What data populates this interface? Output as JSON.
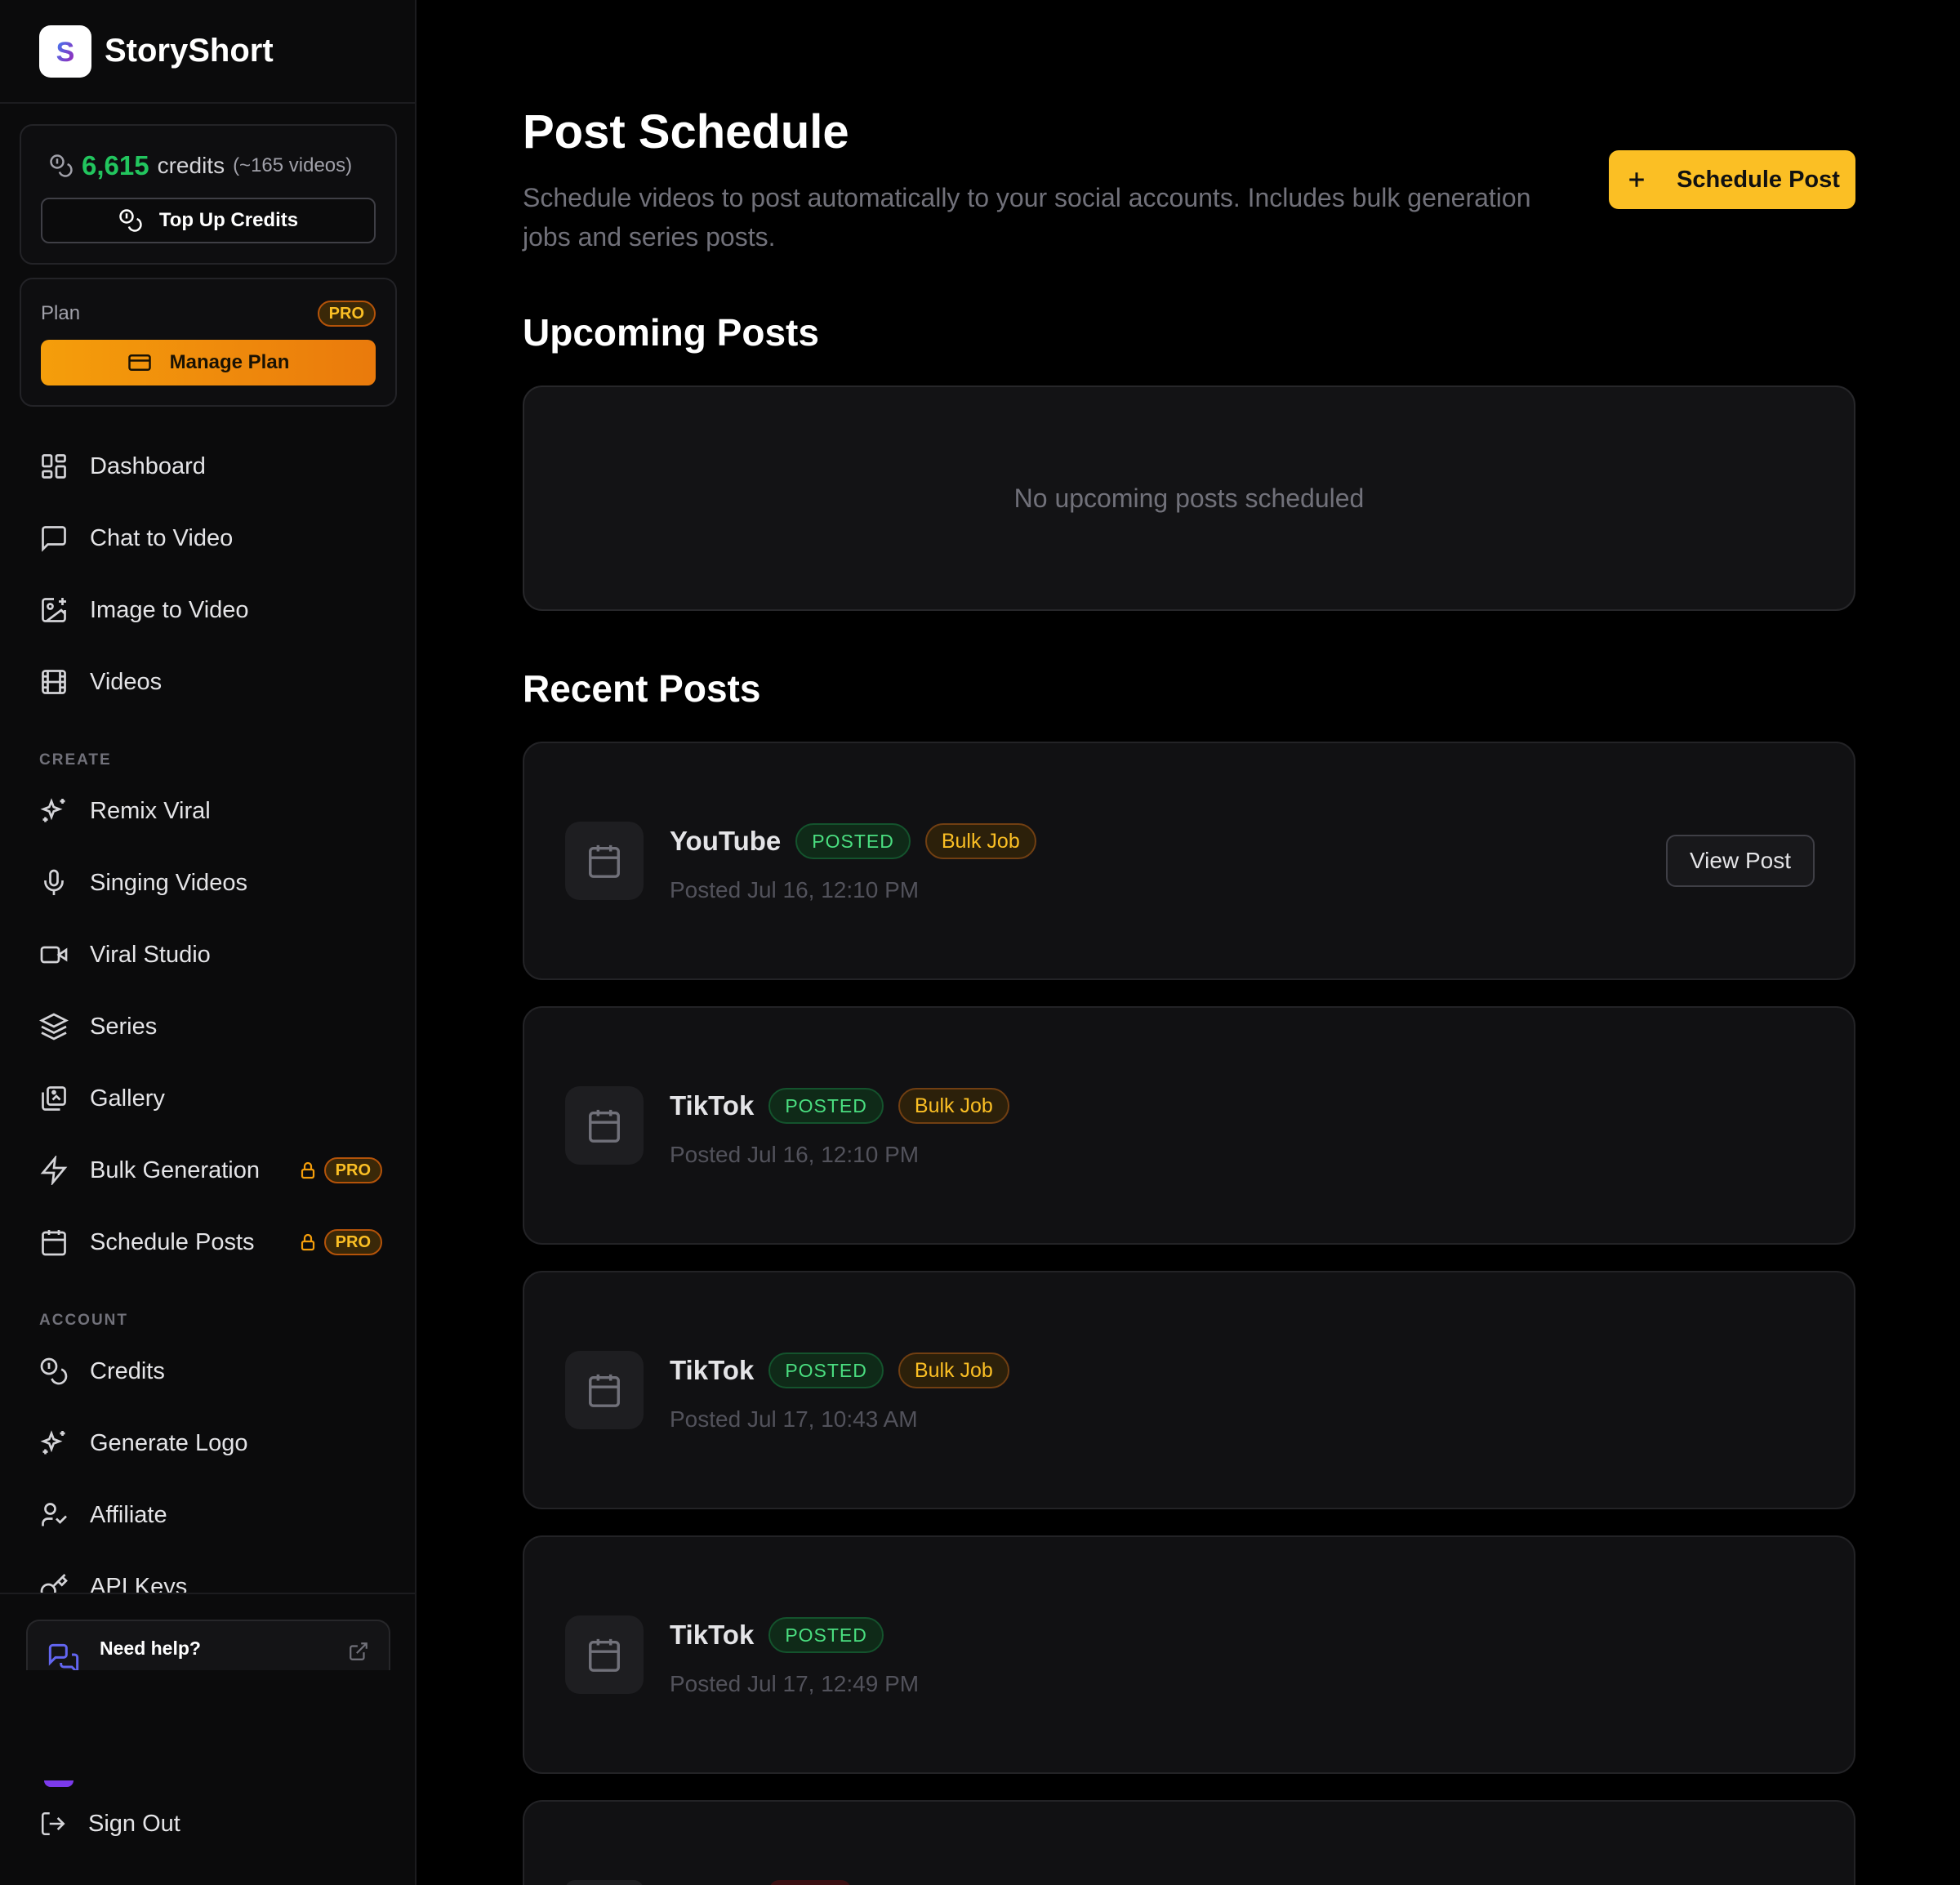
{
  "app": {
    "name": "StoryShort",
    "logo_letter": "S"
  },
  "credits": {
    "amount": "6,615",
    "word": "credits",
    "note": "(~165 videos)",
    "topup_label": "Top Up Credits"
  },
  "plan": {
    "label": "Plan",
    "badge": "PRO",
    "manage_label": "Manage Plan"
  },
  "nav": {
    "main": [
      {
        "label": "Dashboard",
        "icon": "dashboard-icon"
      },
      {
        "label": "Chat to Video",
        "icon": "chat-icon"
      },
      {
        "label": "Image to Video",
        "icon": "image-plus-icon"
      },
      {
        "label": "Videos",
        "icon": "film-icon"
      }
    ],
    "create_heading": "CREATE",
    "create": [
      {
        "label": "Remix Viral",
        "icon": "sparkles-icon"
      },
      {
        "label": "Singing Videos",
        "icon": "mic-icon"
      },
      {
        "label": "Viral Studio",
        "icon": "video-camera-icon"
      },
      {
        "label": "Series",
        "icon": "layers-icon"
      },
      {
        "label": "Gallery",
        "icon": "gallery-icon"
      },
      {
        "label": "Bulk Generation",
        "icon": "zap-icon",
        "badge": "PRO",
        "locked": true
      },
      {
        "label": "Schedule Posts",
        "icon": "calendar-icon",
        "badge": "PRO",
        "locked": true
      }
    ],
    "account_heading": "ACCOUNT",
    "account": [
      {
        "label": "Credits",
        "icon": "coins-icon"
      },
      {
        "label": "Generate Logo",
        "icon": "sparkles-icon"
      },
      {
        "label": "Affiliate",
        "icon": "handshake-icon"
      },
      {
        "label": "API Keys",
        "icon": "key-icon"
      }
    ]
  },
  "help": {
    "title": "Need help?"
  },
  "signout_label": "Sign Out",
  "page": {
    "title": "Post Schedule",
    "subtitle": "Schedule videos to post automatically to your social accounts. Includes bulk generation jobs and series posts.",
    "schedule_button": "Schedule Post"
  },
  "upcoming": {
    "heading": "Upcoming Posts",
    "empty_text": "No upcoming posts scheduled"
  },
  "recent": {
    "heading": "Recent Posts",
    "posts": [
      {
        "platform": "YouTube",
        "status": "POSTED",
        "tag": "Bulk Job",
        "date": "Posted Jul 16, 12:10 PM",
        "action": "View Post"
      },
      {
        "platform": "TikTok",
        "status": "POSTED",
        "tag": "Bulk Job",
        "date": "Posted Jul 16, 12:10 PM"
      },
      {
        "platform": "TikTok",
        "status": "POSTED",
        "tag": "Bulk Job",
        "date": "Posted Jul 17, 10:43 AM"
      },
      {
        "platform": "TikTok",
        "status": "POSTED",
        "date": "Posted Jul 17, 12:49 PM"
      }
    ]
  },
  "colors": {
    "accent_yellow": "#fbbf24",
    "accent_orange": "#f59e0b",
    "credits_green": "#22c55e",
    "posted_green": "#4ade80"
  }
}
